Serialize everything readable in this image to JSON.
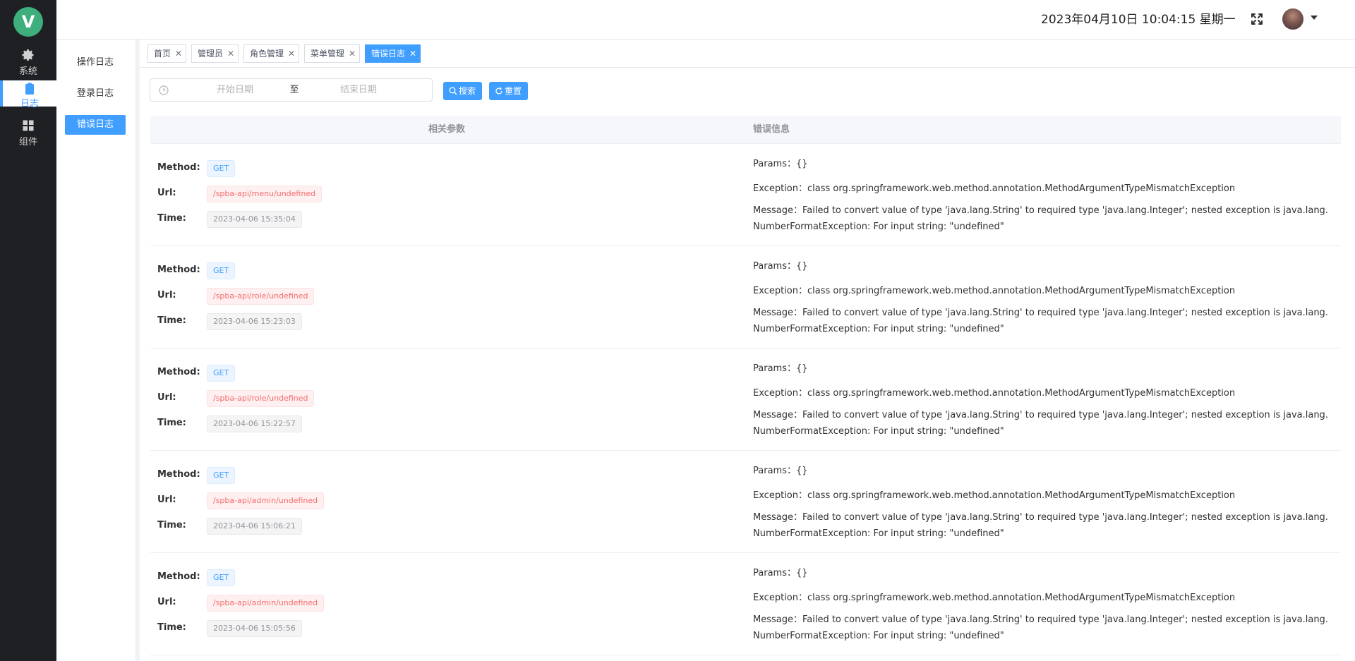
{
  "rail": {
    "items": [
      {
        "label": "系统",
        "icon": "gear-icon"
      },
      {
        "label": "日志",
        "icon": "clipboard-icon"
      },
      {
        "label": "组件",
        "icon": "grid-icon"
      }
    ],
    "logo": "V"
  },
  "header": {
    "datetime": "2023年04月10日 10:04:15 星期一"
  },
  "subnav": {
    "items": [
      "操作日志",
      "登录日志",
      "错误日志"
    ]
  },
  "tabs": [
    {
      "label": "首页"
    },
    {
      "label": "管理员"
    },
    {
      "label": "角色管理"
    },
    {
      "label": "菜单管理"
    },
    {
      "label": "错误日志"
    }
  ],
  "search": {
    "start_placeholder": "开始日期",
    "separator": "至",
    "end_placeholder": "结束日期",
    "search_label": "搜索",
    "reset_label": "重置"
  },
  "table": {
    "col_params": "相关参数",
    "col_error": "错误信息",
    "labels": {
      "method": "Method:",
      "url": "Url:",
      "time": "Time:"
    },
    "rows": [
      {
        "method": "GET",
        "url": "/spba-api/menu/undefined",
        "time": "2023-04-06 15:35:04",
        "params": "Params：{}",
        "exception": "Exception：class org.springframework.web.method.annotation.MethodArgumentTypeMismatchException",
        "message": "Message：Failed to convert value of type 'java.lang.String' to required type 'java.lang.Integer'; nested exception is java.lang.NumberFormatException: For input string: \"undefined\""
      },
      {
        "method": "GET",
        "url": "/spba-api/role/undefined",
        "time": "2023-04-06 15:23:03",
        "params": "Params：{}",
        "exception": "Exception：class org.springframework.web.method.annotation.MethodArgumentTypeMismatchException",
        "message": "Message：Failed to convert value of type 'java.lang.String' to required type 'java.lang.Integer'; nested exception is java.lang.NumberFormatException: For input string: \"undefined\""
      },
      {
        "method": "GET",
        "url": "/spba-api/role/undefined",
        "time": "2023-04-06 15:22:57",
        "params": "Params：{}",
        "exception": "Exception：class org.springframework.web.method.annotation.MethodArgumentTypeMismatchException",
        "message": "Message：Failed to convert value of type 'java.lang.String' to required type 'java.lang.Integer'; nested exception is java.lang.NumberFormatException: For input string: \"undefined\""
      },
      {
        "method": "GET",
        "url": "/spba-api/admin/undefined",
        "time": "2023-04-06 15:06:21",
        "params": "Params：{}",
        "exception": "Exception：class org.springframework.web.method.annotation.MethodArgumentTypeMismatchException",
        "message": "Message：Failed to convert value of type 'java.lang.String' to required type 'java.lang.Integer'; nested exception is java.lang.NumberFormatException: For input string: \"undefined\""
      },
      {
        "method": "GET",
        "url": "/spba-api/admin/undefined",
        "time": "2023-04-06 15:05:56",
        "params": "Params：{}",
        "exception": "Exception：class org.springframework.web.method.annotation.MethodArgumentTypeMismatchException",
        "message": "Message：Failed to convert value of type 'java.lang.String' to required type 'java.lang.Integer'; nested exception is java.lang.NumberFormatException: For input string: \"undefined\""
      }
    ]
  },
  "colors": {
    "primary": "#409eff",
    "sidebar_bg": "#1f2024",
    "logo": "#3eaf7c"
  }
}
